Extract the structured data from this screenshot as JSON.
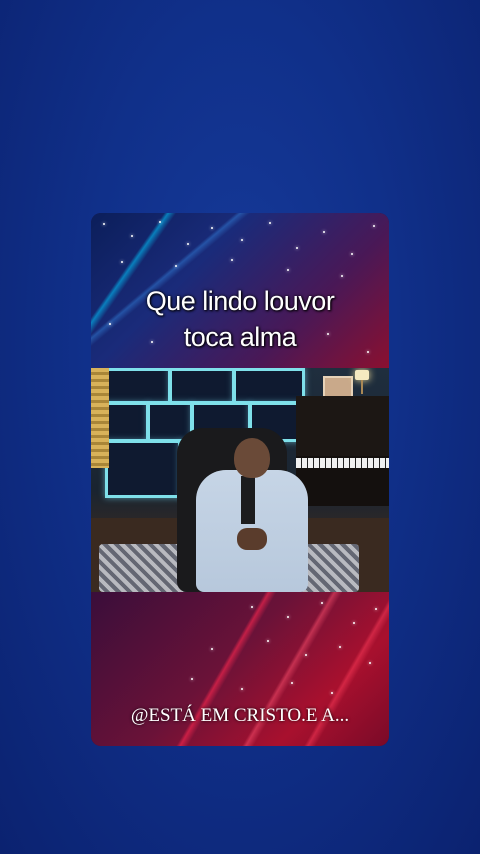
{
  "post": {
    "caption_line1": "Que lindo louvor",
    "caption_line2": "toca alma",
    "watermark": "@ESTÁ EM CRISTO.E A..."
  },
  "colors": {
    "page_background": "#10308a",
    "caption_text": "#ffffff"
  },
  "icons": {
    "stars": "sparkle-stars"
  }
}
